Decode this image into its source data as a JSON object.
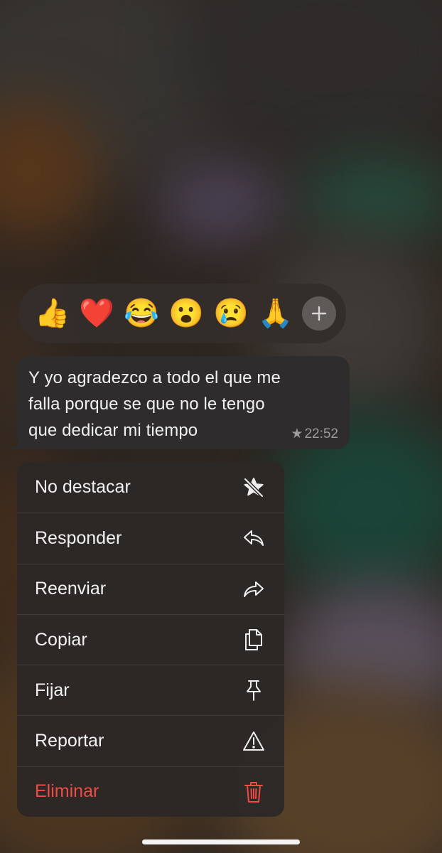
{
  "reactions": {
    "emojis": [
      {
        "icon": "thumbs-up",
        "glyph": "👍"
      },
      {
        "icon": "red-heart",
        "glyph": "❤️"
      },
      {
        "icon": "face-with-tears-of-joy",
        "glyph": "😂"
      },
      {
        "icon": "face-with-open-mouth",
        "glyph": "😮"
      },
      {
        "icon": "crying-face",
        "glyph": "😢"
      },
      {
        "icon": "folded-hands",
        "glyph": "🙏"
      }
    ],
    "more_icon": "plus-icon"
  },
  "message": {
    "lines": [
      "Y yo agradezco a todo el que me",
      "falla porque se que no le tengo",
      "que dedicar mi tiempo"
    ],
    "star_glyph": "★",
    "time": "22:52"
  },
  "menu": {
    "items": [
      {
        "label": "No destacar",
        "icon": "unstar-icon"
      },
      {
        "label": "Responder",
        "icon": "reply-icon"
      },
      {
        "label": "Reenviar",
        "icon": "forward-icon"
      },
      {
        "label": "Copiar",
        "icon": "copy-icon"
      },
      {
        "label": "Fijar",
        "icon": "pin-icon"
      },
      {
        "label": "Reportar",
        "icon": "warning-icon"
      },
      {
        "label": "Eliminar",
        "icon": "trash-icon",
        "color": "#ee4c45"
      }
    ]
  },
  "colors": {
    "bubble": "#2e2c2c",
    "menu": "#2c2826",
    "danger": "#ee4c45",
    "text": "#f2f2f2"
  }
}
